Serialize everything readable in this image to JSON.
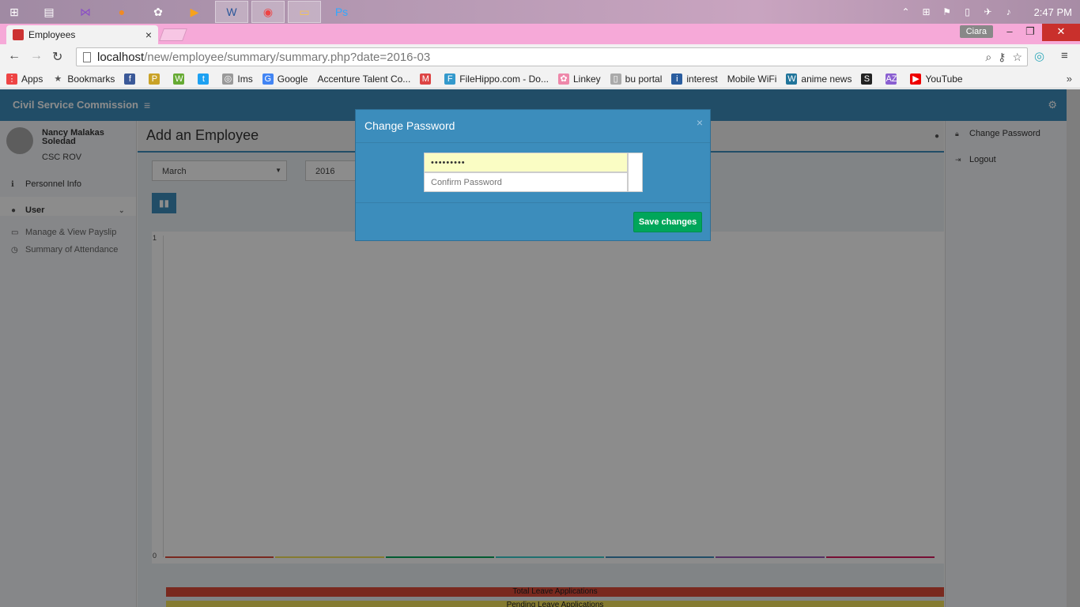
{
  "taskbar": {
    "time": "2:47 PM",
    "apps": [
      "windows-start",
      "notepad",
      "visual-studio",
      "firefox",
      "paint",
      "media-player",
      "word",
      "chrome",
      "file-explorer",
      "photoshop"
    ]
  },
  "browser": {
    "tab_title": "Employees",
    "profile_name": "Ciara",
    "url_host": "localhost",
    "url_path": "/new/employee/summary/summary.php?date=2016-03"
  },
  "bookmarks": [
    {
      "label": "Apps",
      "icon": "apps-grid-icon",
      "color": "#e44"
    },
    {
      "label": "Bookmarks",
      "icon": "star-icon",
      "color": "#555"
    },
    {
      "label": "",
      "icon": "facebook-icon",
      "color": "#3b5998"
    },
    {
      "label": "",
      "icon": "pma-icon",
      "color": "#c9a227"
    },
    {
      "label": "",
      "icon": "mw-icon",
      "color": "#6a3"
    },
    {
      "label": "",
      "icon": "twitter-icon",
      "color": "#1da1f2"
    },
    {
      "label": "Ims",
      "icon": "ims-icon",
      "color": "#999"
    },
    {
      "label": "Google",
      "icon": "google-icon",
      "color": "#4285f4"
    },
    {
      "label": "Accenture Talent Co...",
      "icon": "",
      "color": ""
    },
    {
      "label": "",
      "icon": "gmail-icon",
      "color": "#d44"
    },
    {
      "label": "FileHippo.com - Do...",
      "icon": "filehippo-icon",
      "color": "#39c"
    },
    {
      "label": "Linkey",
      "icon": "linkey-icon",
      "color": "#e8a"
    },
    {
      "label": "bu portal",
      "icon": "page-icon",
      "color": "#aaa"
    },
    {
      "label": "interest",
      "icon": "interest-icon",
      "color": "#2a5d9f"
    },
    {
      "label": "Mobile WiFi",
      "icon": "",
      "color": ""
    },
    {
      "label": "anime news",
      "icon": "wordpress-icon",
      "color": "#21759b"
    },
    {
      "label": "",
      "icon": "squarespace-icon",
      "color": "#222"
    },
    {
      "label": "",
      "icon": "az-icon",
      "color": "#8a5fd1"
    },
    {
      "label": "YouTube",
      "icon": "youtube-icon",
      "color": "#e00"
    }
  ],
  "app": {
    "brand": "Civil Service Commission",
    "user_name": "Nancy Malakas Soledad",
    "user_org": "CSC  ROV",
    "nav": {
      "personnel_info": "Personnel Info",
      "user": "User",
      "manage_payslip": "Manage & View Payslip",
      "attendance": "Summary of Attendance"
    },
    "page_title": "Add an Employee",
    "month_select": "March",
    "year_select": "2016",
    "right_panel": {
      "change_password": "Change Password",
      "logout": "Logout"
    },
    "legend": {
      "total": "Total Leave Applications",
      "pending": "Pending Leave Applications"
    }
  },
  "chart_data": {
    "type": "bar",
    "categories": [
      "",
      "",
      "",
      "",
      "",
      "",
      ""
    ],
    "values": [
      0,
      0,
      0,
      0,
      0,
      0,
      0
    ],
    "ylim": [
      0,
      1
    ],
    "yticks": [
      "1",
      "0"
    ],
    "series_colors": [
      "#dd4b39",
      "#f3e05a",
      "#00a65a",
      "#39cccc",
      "#3c8dbc",
      "#9b59b6",
      "#d81b60"
    ]
  },
  "modal": {
    "title": "Change Password",
    "close": "×",
    "password_value": "•••••••••",
    "confirm_placeholder": "Confirm Password",
    "save_label": "Save changes"
  }
}
